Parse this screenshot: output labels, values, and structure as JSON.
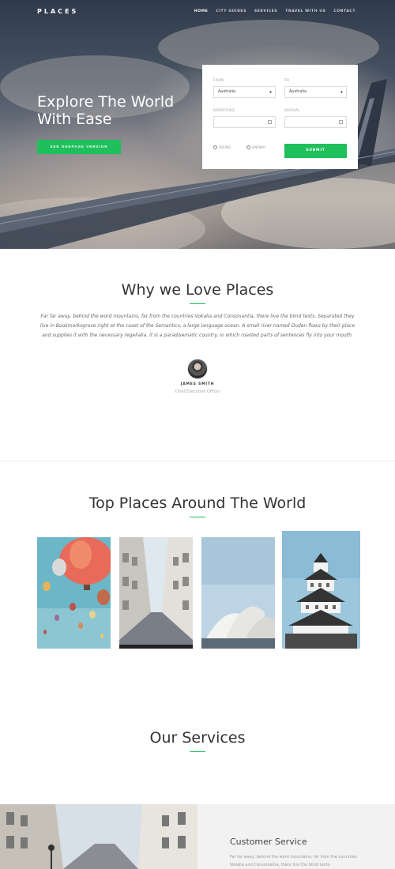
{
  "nav": {
    "brand": "PLACES",
    "links": [
      "HOME",
      "CITY GUIDES",
      "SERVICES",
      "TRAVEL WITH US",
      "CONTACT"
    ]
  },
  "hero": {
    "title": "Explore The World With Ease",
    "button_label": "SEE ONEPAGE VERSION"
  },
  "booking": {
    "from_label": "FROM",
    "from_value": "Australia",
    "to_label": "TO",
    "to_value": "Australia",
    "departure_label": "DEPARTURE",
    "arrival_label": "ARRIVAL",
    "round_label": "ROUND",
    "oneway_label": "ONEWAY",
    "submit_label": "SUBMIT"
  },
  "why": {
    "title": "Why we Love Places",
    "text": "Far far away, behind the word mountains, far from the countries Vokalia and Consonantia, there live the blind texts. Separated they live in Bookmarksgrove right at the coast of the Semantics, a large language ocean. A small river named Duden flows by their place and supplies it with the necessary regelialia. It is a paradisematic country, in which roasted parts of sentences fly into your mouth.",
    "person_name": "JAMES SMITH",
    "person_role": "Chief Executive Officer"
  },
  "places": {
    "title": "Top Places Around The World",
    "items": [
      "hot-air-balloons",
      "city-street",
      "opera-house",
      "japanese-castle"
    ]
  },
  "services": {
    "title": "Our Services",
    "card_title": "Customer Service",
    "card_text": "Far far away, behind the word mountains, far from the countries Vokalia and Consonantia, there live the blind texts."
  },
  "colors": {
    "accent": "#1fbf5c",
    "text": "#333333"
  }
}
